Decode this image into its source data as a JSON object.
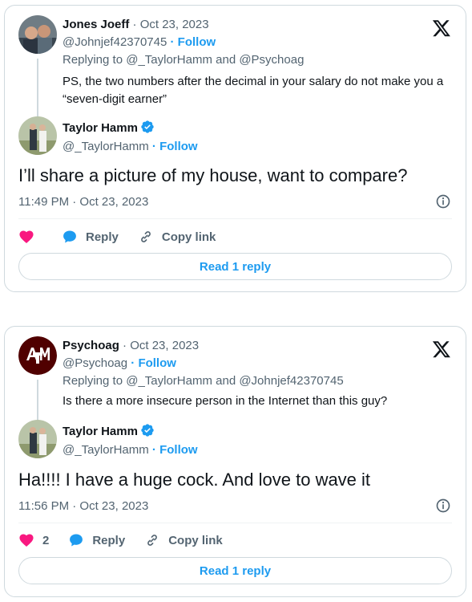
{
  "colors": {
    "accent": "#1d9bf0",
    "like": "#f91880",
    "text": "#0f1419",
    "muted": "#536471",
    "border": "#cfd9de"
  },
  "tweets": [
    {
      "parent": {
        "name": "Jones Joeff",
        "date": "· Oct 23, 2023",
        "handle": "@Johnjef42370745",
        "follow": "· Follow",
        "replying_prefix": "Replying to",
        "replying_handles": "@_TaylorHamm and @Psychoag",
        "text": "PS, the two numbers after the decimal in your salary do not make you a “seven-digit earner”"
      },
      "reply": {
        "name": "Taylor Hamm",
        "handle": "@_TaylorHamm",
        "follow": "· Follow",
        "text": "I’ll share a picture of my house, want to compare?",
        "timestamp": "11:49 PM · Oct 23, 2023",
        "like_count": "",
        "reply_label": "Reply",
        "copy_label": "Copy link",
        "read_label": "Read 1 reply"
      }
    },
    {
      "parent": {
        "name": "Psychoag",
        "date": "· Oct 23, 2023",
        "handle": "@Psychoag",
        "follow": "· Follow",
        "replying_prefix": "Replying to",
        "replying_handles": "@_TaylorHamm and @Johnjef42370745",
        "text": "Is there a more insecure person in the Internet than this guy?"
      },
      "reply": {
        "name": "Taylor Hamm",
        "handle": "@_TaylorHamm",
        "follow": "· Follow",
        "text": "Ha!!!! I have a huge cock. And love to wave it",
        "timestamp": "11:56 PM · Oct 23, 2023",
        "like_count": "2",
        "reply_label": "Reply",
        "copy_label": "Copy link",
        "read_label": "Read 1 reply"
      }
    }
  ]
}
